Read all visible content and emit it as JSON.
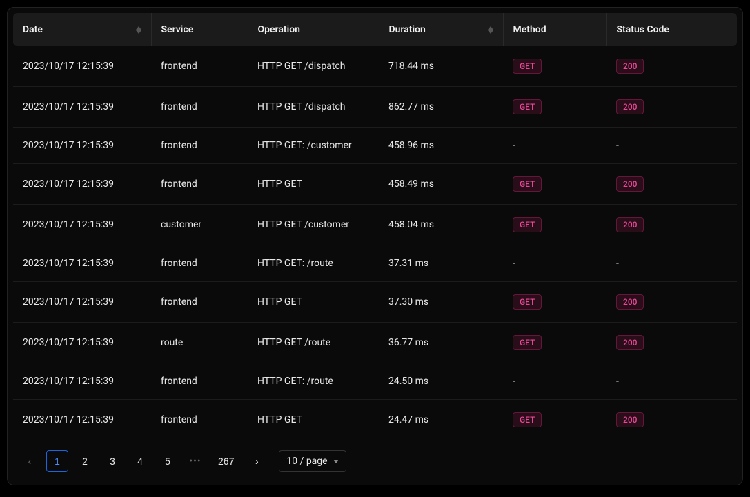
{
  "columns": {
    "date": "Date",
    "service": "Service",
    "operation": "Operation",
    "duration": "Duration",
    "method": "Method",
    "status": "Status Code"
  },
  "rows": [
    {
      "date": "2023/10/17 12:15:39",
      "service": "frontend",
      "operation": "HTTP GET /dispatch",
      "duration": "718.44 ms",
      "method": "GET",
      "status": "200"
    },
    {
      "date": "2023/10/17 12:15:39",
      "service": "frontend",
      "operation": "HTTP GET /dispatch",
      "duration": "862.77 ms",
      "method": "GET",
      "status": "200"
    },
    {
      "date": "2023/10/17 12:15:39",
      "service": "frontend",
      "operation": "HTTP GET: /customer",
      "duration": "458.96 ms",
      "method": "-",
      "status": "-"
    },
    {
      "date": "2023/10/17 12:15:39",
      "service": "frontend",
      "operation": "HTTP GET",
      "duration": "458.49 ms",
      "method": "GET",
      "status": "200"
    },
    {
      "date": "2023/10/17 12:15:39",
      "service": "customer",
      "operation": "HTTP GET /customer",
      "duration": "458.04 ms",
      "method": "GET",
      "status": "200"
    },
    {
      "date": "2023/10/17 12:15:39",
      "service": "frontend",
      "operation": "HTTP GET: /route",
      "duration": "37.31 ms",
      "method": "-",
      "status": "-"
    },
    {
      "date": "2023/10/17 12:15:39",
      "service": "frontend",
      "operation": "HTTP GET",
      "duration": "37.30 ms",
      "method": "GET",
      "status": "200"
    },
    {
      "date": "2023/10/17 12:15:39",
      "service": "route",
      "operation": "HTTP GET /route",
      "duration": "36.77 ms",
      "method": "GET",
      "status": "200"
    },
    {
      "date": "2023/10/17 12:15:39",
      "service": "frontend",
      "operation": "HTTP GET: /route",
      "duration": "24.50 ms",
      "method": "-",
      "status": "-"
    },
    {
      "date": "2023/10/17 12:15:39",
      "service": "frontend",
      "operation": "HTTP GET",
      "duration": "24.47 ms",
      "method": "GET",
      "status": "200"
    }
  ],
  "pagination": {
    "prev_icon": "‹",
    "next_icon": "›",
    "pages": [
      "1",
      "2",
      "3",
      "4",
      "5"
    ],
    "ellipsis": "•••",
    "last": "267",
    "page_size_label": "10 / page"
  },
  "colors": {
    "accent_pink": "#ec4899",
    "accent_blue": "#1a66e0"
  }
}
